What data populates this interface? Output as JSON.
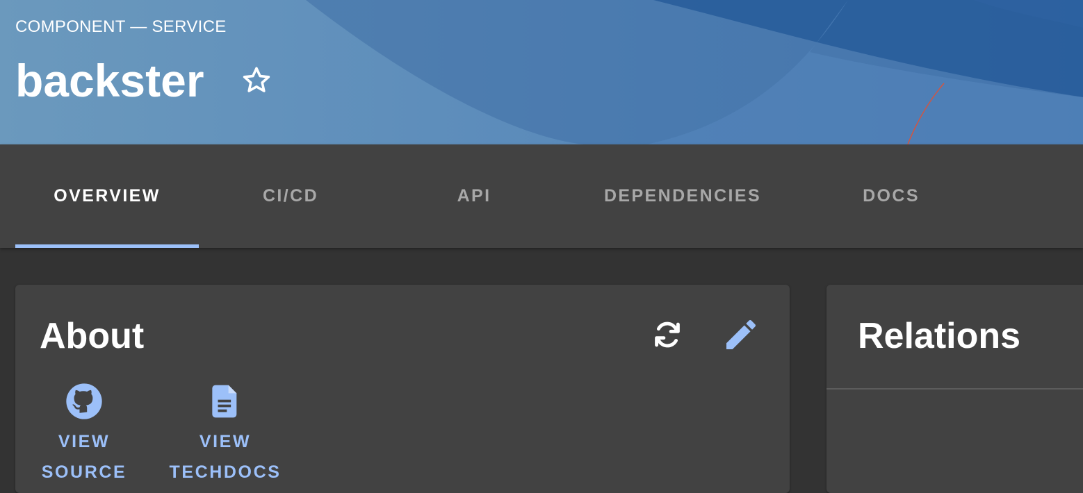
{
  "header": {
    "kind": "COMPONENT — SERVICE",
    "title": "backster",
    "star_icon": "star-outline-icon"
  },
  "tabs": [
    {
      "label": "OVERVIEW",
      "active": true
    },
    {
      "label": "CI/CD",
      "active": false
    },
    {
      "label": "API",
      "active": false
    },
    {
      "label": "DEPENDENCIES",
      "active": false
    },
    {
      "label": "DOCS",
      "active": false
    }
  ],
  "about": {
    "title": "About",
    "refresh_icon": "refresh-icon",
    "edit_icon": "edit-icon",
    "links": [
      {
        "label": "VIEW\nSOURCE",
        "icon": "github-icon"
      },
      {
        "label": "VIEW\nTECHDOCS",
        "icon": "document-icon"
      }
    ]
  },
  "relations": {
    "title": "Relations"
  },
  "colors": {
    "accent": "#9cc0f9",
    "background": "#333333",
    "surface": "#424242",
    "header_blue": "#4a7fb1",
    "annotation": "#d9533b"
  }
}
